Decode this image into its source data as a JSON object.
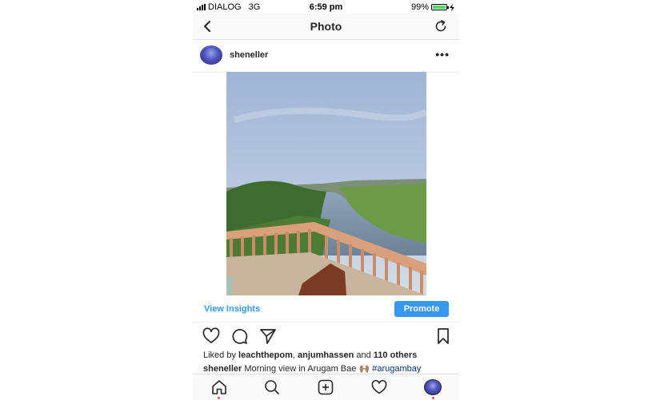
{
  "status_bar": {
    "carrier": "DIALOG",
    "network": "3G",
    "time": "6:59 pm",
    "battery": "99%",
    "battery_level": 0.99
  },
  "header": {
    "title": "Photo",
    "back_icon": "chevron-left-icon",
    "refresh_icon": "refresh-icon"
  },
  "post": {
    "username": "sheneller",
    "more_icon": "more-icon",
    "view_insights": "View Insights",
    "promote": "Promote",
    "likes": {
      "prefix": "Liked by ",
      "user1": "leachthepom",
      "sep": ", ",
      "user2": "anjumhassen",
      "and": " and ",
      "others": "110 others"
    },
    "caption": {
      "user": "sheneller",
      "text": " Morning view in Arugam Bae 🙌🏽 ",
      "hashtag": "#arugambay"
    }
  },
  "tab_bar": {
    "items": [
      "home-icon",
      "search-icon",
      "add-icon",
      "heart-icon",
      "profile-avatar"
    ]
  },
  "colors": {
    "accent": "#3897f0",
    "notification": "#ed4956",
    "battery": "#4cd964"
  }
}
